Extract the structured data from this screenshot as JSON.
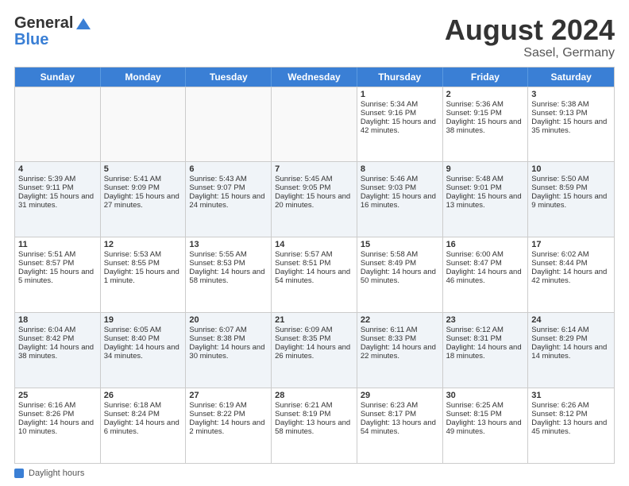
{
  "header": {
    "logo_general": "General",
    "logo_blue": "Blue",
    "title": "August 2024",
    "subtitle": "Sasel, Germany"
  },
  "weekdays": [
    "Sunday",
    "Monday",
    "Tuesday",
    "Wednesday",
    "Thursday",
    "Friday",
    "Saturday"
  ],
  "weeks": [
    [
      {
        "day": "",
        "empty": true
      },
      {
        "day": "",
        "empty": true
      },
      {
        "day": "",
        "empty": true
      },
      {
        "day": "",
        "empty": true
      },
      {
        "day": "1",
        "sunrise": "5:34 AM",
        "sunset": "9:16 PM",
        "daylight": "15 hours and 42 minutes."
      },
      {
        "day": "2",
        "sunrise": "5:36 AM",
        "sunset": "9:15 PM",
        "daylight": "15 hours and 38 minutes."
      },
      {
        "day": "3",
        "sunrise": "5:38 AM",
        "sunset": "9:13 PM",
        "daylight": "15 hours and 35 minutes."
      }
    ],
    [
      {
        "day": "4",
        "sunrise": "5:39 AM",
        "sunset": "9:11 PM",
        "daylight": "15 hours and 31 minutes."
      },
      {
        "day": "5",
        "sunrise": "5:41 AM",
        "sunset": "9:09 PM",
        "daylight": "15 hours and 27 minutes."
      },
      {
        "day": "6",
        "sunrise": "5:43 AM",
        "sunset": "9:07 PM",
        "daylight": "15 hours and 24 minutes."
      },
      {
        "day": "7",
        "sunrise": "5:45 AM",
        "sunset": "9:05 PM",
        "daylight": "15 hours and 20 minutes."
      },
      {
        "day": "8",
        "sunrise": "5:46 AM",
        "sunset": "9:03 PM",
        "daylight": "15 hours and 16 minutes."
      },
      {
        "day": "9",
        "sunrise": "5:48 AM",
        "sunset": "9:01 PM",
        "daylight": "15 hours and 13 minutes."
      },
      {
        "day": "10",
        "sunrise": "5:50 AM",
        "sunset": "8:59 PM",
        "daylight": "15 hours and 9 minutes."
      }
    ],
    [
      {
        "day": "11",
        "sunrise": "5:51 AM",
        "sunset": "8:57 PM",
        "daylight": "15 hours and 5 minutes."
      },
      {
        "day": "12",
        "sunrise": "5:53 AM",
        "sunset": "8:55 PM",
        "daylight": "15 hours and 1 minute."
      },
      {
        "day": "13",
        "sunrise": "5:55 AM",
        "sunset": "8:53 PM",
        "daylight": "14 hours and 58 minutes."
      },
      {
        "day": "14",
        "sunrise": "5:57 AM",
        "sunset": "8:51 PM",
        "daylight": "14 hours and 54 minutes."
      },
      {
        "day": "15",
        "sunrise": "5:58 AM",
        "sunset": "8:49 PM",
        "daylight": "14 hours and 50 minutes."
      },
      {
        "day": "16",
        "sunrise": "6:00 AM",
        "sunset": "8:47 PM",
        "daylight": "14 hours and 46 minutes."
      },
      {
        "day": "17",
        "sunrise": "6:02 AM",
        "sunset": "8:44 PM",
        "daylight": "14 hours and 42 minutes."
      }
    ],
    [
      {
        "day": "18",
        "sunrise": "6:04 AM",
        "sunset": "8:42 PM",
        "daylight": "14 hours and 38 minutes."
      },
      {
        "day": "19",
        "sunrise": "6:05 AM",
        "sunset": "8:40 PM",
        "daylight": "14 hours and 34 minutes."
      },
      {
        "day": "20",
        "sunrise": "6:07 AM",
        "sunset": "8:38 PM",
        "daylight": "14 hours and 30 minutes."
      },
      {
        "day": "21",
        "sunrise": "6:09 AM",
        "sunset": "8:35 PM",
        "daylight": "14 hours and 26 minutes."
      },
      {
        "day": "22",
        "sunrise": "6:11 AM",
        "sunset": "8:33 PM",
        "daylight": "14 hours and 22 minutes."
      },
      {
        "day": "23",
        "sunrise": "6:12 AM",
        "sunset": "8:31 PM",
        "daylight": "14 hours and 18 minutes."
      },
      {
        "day": "24",
        "sunrise": "6:14 AM",
        "sunset": "8:29 PM",
        "daylight": "14 hours and 14 minutes."
      }
    ],
    [
      {
        "day": "25",
        "sunrise": "6:16 AM",
        "sunset": "8:26 PM",
        "daylight": "14 hours and 10 minutes."
      },
      {
        "day": "26",
        "sunrise": "6:18 AM",
        "sunset": "8:24 PM",
        "daylight": "14 hours and 6 minutes."
      },
      {
        "day": "27",
        "sunrise": "6:19 AM",
        "sunset": "8:22 PM",
        "daylight": "14 hours and 2 minutes."
      },
      {
        "day": "28",
        "sunrise": "6:21 AM",
        "sunset": "8:19 PM",
        "daylight": "13 hours and 58 minutes."
      },
      {
        "day": "29",
        "sunrise": "6:23 AM",
        "sunset": "8:17 PM",
        "daylight": "13 hours and 54 minutes."
      },
      {
        "day": "30",
        "sunrise": "6:25 AM",
        "sunset": "8:15 PM",
        "daylight": "13 hours and 49 minutes."
      },
      {
        "day": "31",
        "sunrise": "6:26 AM",
        "sunset": "8:12 PM",
        "daylight": "13 hours and 45 minutes."
      }
    ]
  ],
  "footer": {
    "legend_label": "Daylight hours"
  }
}
